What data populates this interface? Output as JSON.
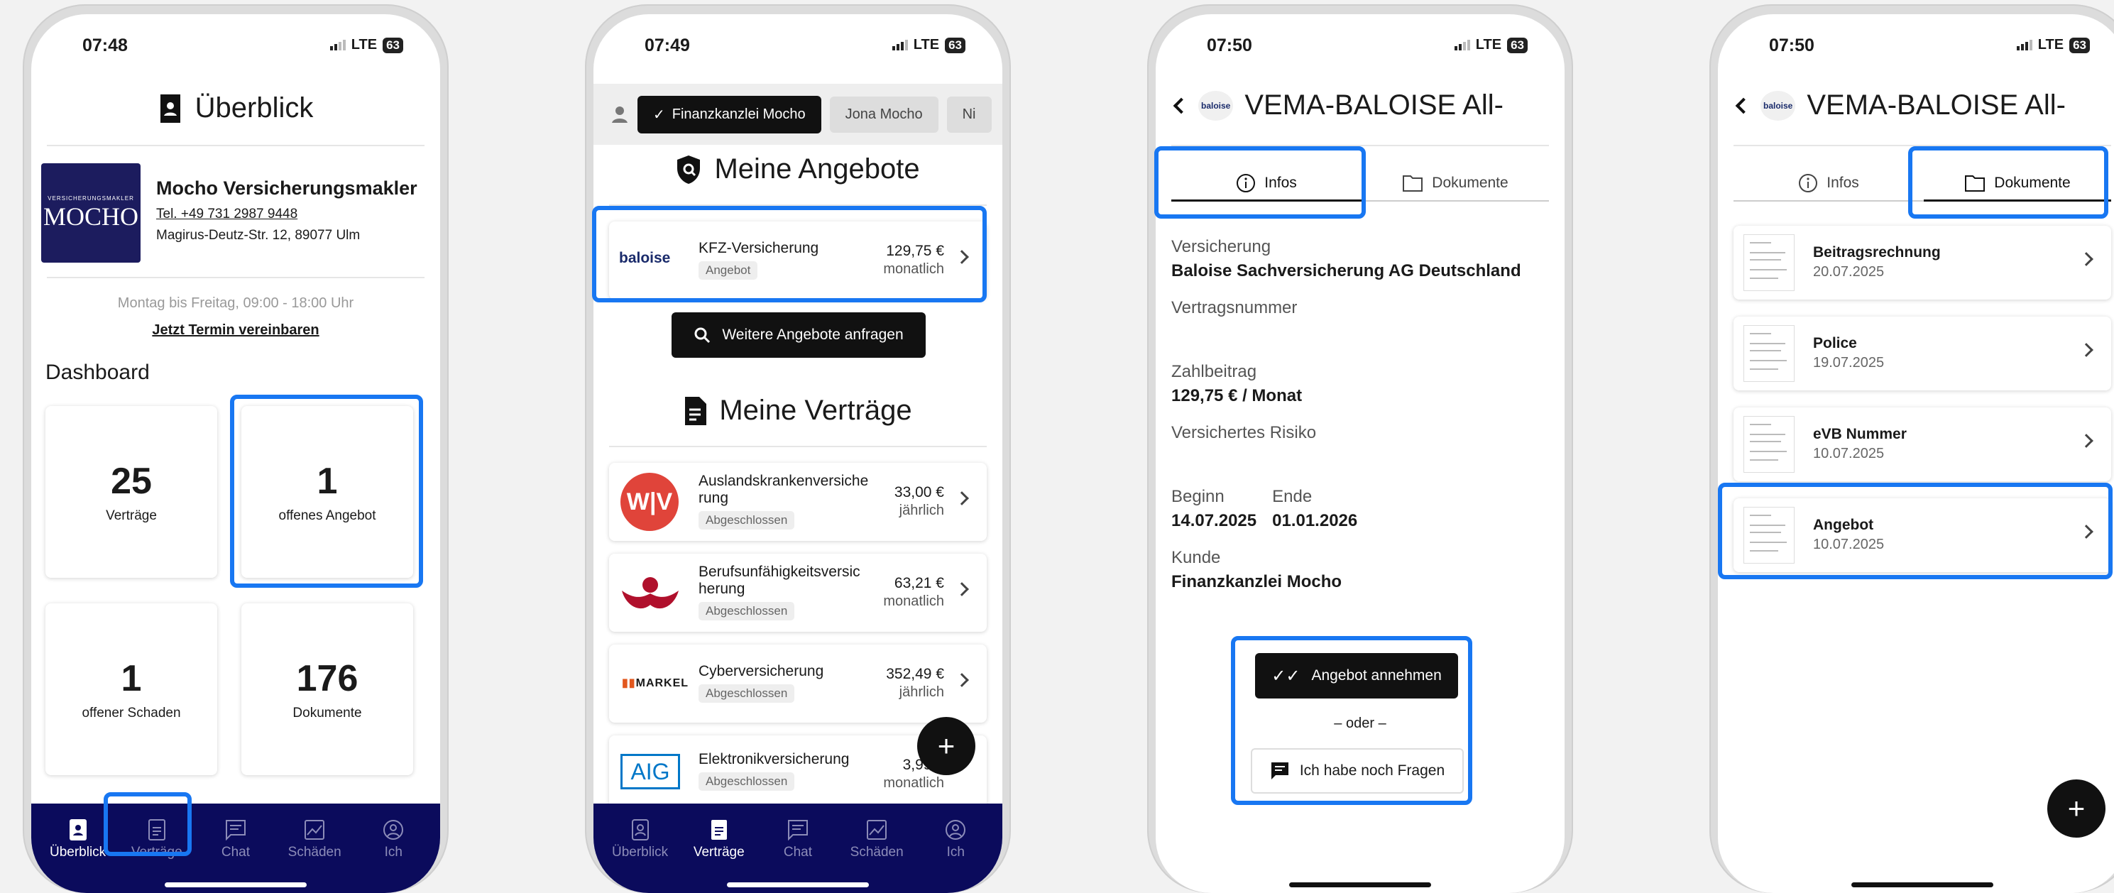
{
  "phone1": {
    "time": "07:48",
    "network": "LTE",
    "battery": "63",
    "title": "Überblick",
    "broker": {
      "logo_small": "VERSICHERUNGSMAKLER",
      "logo_big": "MOCHO",
      "name": "Mocho Versicherungsmakler",
      "phone": "Tel. +49 731 2987 9448",
      "address": "Magirus-Deutz-Str. 12, 89077 Ulm"
    },
    "hours": "Montag bis Freitag, 09:00 - 18:00 Uhr",
    "appointment_link": "Jetzt Termin vereinbaren",
    "dashboard_title": "Dashboard",
    "tiles": [
      {
        "num": "25",
        "label": "Verträge"
      },
      {
        "num": "1",
        "label": "offenes Angebot"
      },
      {
        "num": "1",
        "label": "offener Schaden"
      },
      {
        "num": "176",
        "label": "Dokumente"
      }
    ]
  },
  "nav": [
    "Überblick",
    "Verträge",
    "Chat",
    "Schäden",
    "Ich"
  ],
  "phone2": {
    "time": "07:49",
    "network": "LTE",
    "battery": "63",
    "chips": [
      "Finanzkanzlei Mocho",
      "Jona Mocho",
      "Ni"
    ],
    "offers_title": "Meine Angebote",
    "offer": {
      "insurer": "baloise",
      "name": "KFZ-Versicherung",
      "status": "Angebot",
      "price": "129,75 €",
      "period": "monatlich"
    },
    "more_offers_button": "Weitere Angebote anfragen",
    "contracts_title": "Meine Verträge",
    "contracts": [
      {
        "insurer": "W|V",
        "name": "Auslandskrankenversiche rung",
        "status": "Abgeschlossen",
        "price": "33,00 €",
        "period": "jährlich"
      },
      {
        "insurer": "signal",
        "name": "Berufsunfähigkeitsversic herung",
        "status": "Abgeschlossen",
        "price": "63,21 €",
        "period": "monatlich"
      },
      {
        "insurer": "MARKEL",
        "name": "Cyberversicherung",
        "status": "Abgeschlossen",
        "price": "352,49 €",
        "period": "jährlich"
      },
      {
        "insurer": "AIG",
        "name": "Elektronikversicherung",
        "status": "Abgeschlossen",
        "price": "3,99 €",
        "period": "monatlich"
      }
    ]
  },
  "phone3": {
    "time": "07:50",
    "network": "LTE",
    "battery": "63",
    "title": "VEMA-BALOISE All-",
    "logo": "baloise",
    "tabs": [
      "Infos",
      "Dokumente"
    ],
    "fields": {
      "versicherung_label": "Versicherung",
      "versicherung": "Baloise Sachversicherung AG Deutschland",
      "vertragsnummer_label": "Vertragsnummer",
      "zahlbeitrag_label": "Zahlbeitrag",
      "zahlbeitrag": "129,75 € / Monat",
      "risiko_label": "Versichertes Risiko",
      "beginn_label": "Beginn",
      "beginn": "14.07.2025",
      "ende_label": "Ende",
      "ende": "01.01.2026",
      "kunde_label": "Kunde",
      "kunde": "Finanzkanzlei Mocho"
    },
    "accept_button": "Angebot annehmen",
    "or": "– oder –",
    "question_button": "Ich habe noch Fragen"
  },
  "phone4": {
    "time": "07:50",
    "network": "LTE",
    "battery": "63",
    "title": "VEMA-BALOISE All-",
    "logo": "baloise",
    "tabs": [
      "Infos",
      "Dokumente"
    ],
    "docs": [
      {
        "name": "Beitragsrechnung",
        "date": "20.07.2025"
      },
      {
        "name": "Police",
        "date": "19.07.2025"
      },
      {
        "name": "eVB Nummer",
        "date": "10.07.2025"
      },
      {
        "name": "Angebot",
        "date": "10.07.2025"
      }
    ]
  },
  "colors": {
    "navy": "#0b0b5c",
    "highlight": "#1877f2",
    "dark": "#111111"
  }
}
